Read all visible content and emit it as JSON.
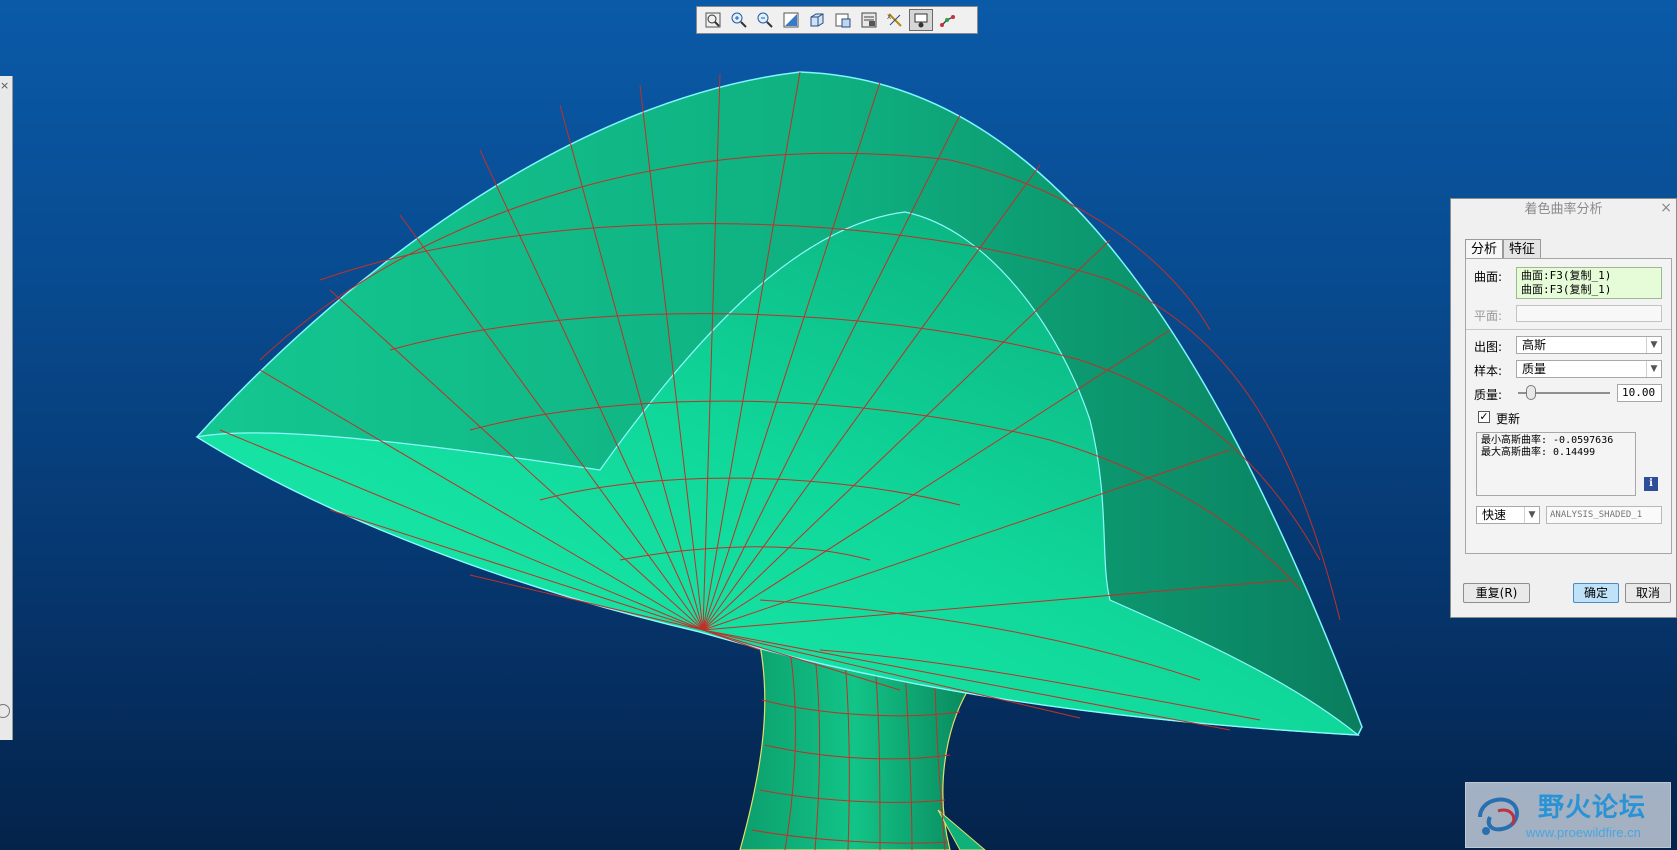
{
  "toolbar": {
    "buttons": [
      {
        "icon": "refit-icon"
      },
      {
        "icon": "zoom-in-icon"
      },
      {
        "icon": "zoom-out-icon"
      },
      {
        "icon": "repaint-icon"
      },
      {
        "icon": "view-orientation-icon"
      },
      {
        "icon": "saved-views-icon"
      },
      {
        "icon": "layers-icon"
      },
      {
        "icon": "datum-display-icon"
      },
      {
        "icon": "display-style-icon"
      },
      {
        "icon": "spin-center-icon"
      }
    ]
  },
  "colors": {
    "background_top": "#0a5aa8",
    "background_bottom": "#04234a",
    "surface": "#10d89a",
    "mesh_lines": "#c0302a",
    "edge_highlight": "#7ff5ff"
  },
  "dialog": {
    "title": "着色曲率分析",
    "close": "×",
    "tabs": [
      "分析",
      "特征"
    ],
    "surface_label": "曲面:",
    "surface_values": [
      "曲面:F3(复制_1)",
      "曲面:F3(复制_1)"
    ],
    "plane_label": "平面:",
    "output_label": "出图:",
    "output_value": "高斯",
    "sample_label": "样本:",
    "sample_value": "质量",
    "quality_label": "质量:",
    "quality_value": "10.00",
    "quality_slider_fraction": 0.1,
    "update_label": "更新",
    "update_checked": true,
    "result_lines": [
      "最小高斯曲率: -0.0597636",
      "最大高斯曲率: 0.14499"
    ],
    "info_icon": "i",
    "speed_value": "快速",
    "saved_name": "ANALYSIS_SHADED_1",
    "repeat_button": "重复(R)",
    "ok_button": "确定",
    "cancel_button": "取消"
  },
  "watermark": {
    "title": "野火论坛",
    "url": "www.proewildfire.cn"
  }
}
